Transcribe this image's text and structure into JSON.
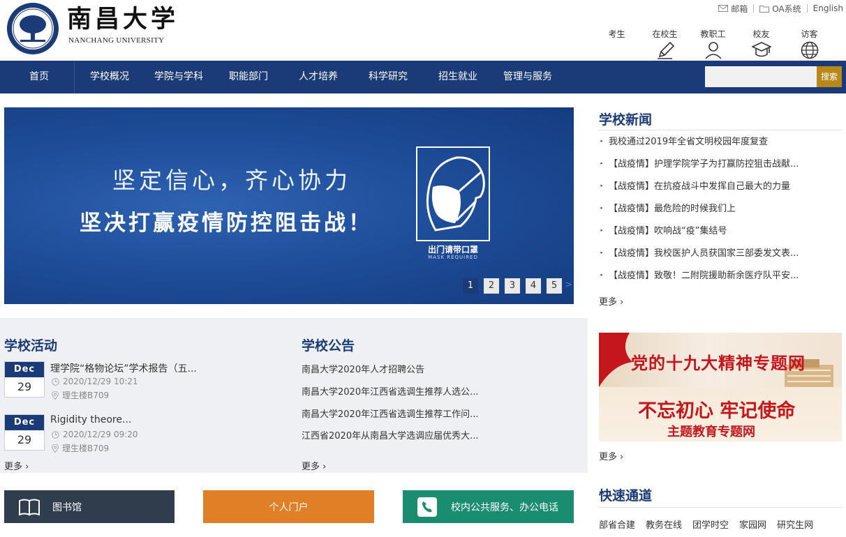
{
  "header": {
    "logo_cn": "南昌大学",
    "logo_en": "NANCHANG UNIVERSITY",
    "toplinks": {
      "mail": "邮箱",
      "oa": "OA系统",
      "english": "English"
    },
    "roles": [
      "考生",
      "在校生",
      "教职工",
      "校友",
      "访客"
    ]
  },
  "nav": {
    "items": [
      "首页",
      "学校概况",
      "学院与学科",
      "职能部门",
      "人才培养",
      "科学研究",
      "招生就业",
      "管理与服务"
    ],
    "search_button": "搜索",
    "search_placeholder": ""
  },
  "banner": {
    "line1": "坚定信心，齐心协力",
    "line2": "坚决打赢疫情防控阻击战！",
    "mask_caption": "出门请带口罩",
    "mask_caption_en": "MASK REQUIRED",
    "pages": [
      "1",
      "2",
      "3",
      "4",
      "5"
    ],
    "next": ">"
  },
  "news": {
    "title": "学校新闻",
    "items": [
      "我校通过2019年全省文明校园年度复查",
      "【战疫情】护理学院学子为打赢防控狙击战献...",
      "【战疫情】在抗疫战斗中发挥自己最大的力量",
      "【战疫情】最危险的时候我们上",
      "【战疫情】吹响战“疫”集结号",
      "【战疫情】我校医护人员获国家三部委发文表...",
      "【战疫情】致敬！二附院援助新余医疗队平安..."
    ],
    "more": "更多 ›"
  },
  "activities": {
    "title": "学校活动",
    "items": [
      {
        "month": "Dec",
        "day": "29",
        "title": "理学院“格物论坛”学术报告（五...",
        "time": "2020/12/29 10:21",
        "place": "理生楼B709"
      },
      {
        "month": "Dec",
        "day": "29",
        "title": "Rigidity theore...",
        "time": "2020/12/29 09:20",
        "place": "理生楼B709"
      }
    ],
    "more": "更多 ›"
  },
  "notices": {
    "title": "学校公告",
    "items": [
      "南昌大学2020年人才招聘公告",
      "南昌大学2020年江西省选调生推荐人选公...",
      "南昌大学2020年江西省选调生推荐工作问...",
      "江西省2020年从南昌大学选调应届优秀大..."
    ],
    "more": "更多 ›"
  },
  "promo": {
    "line1": "党的十九大精神专题网",
    "line2": "不忘初心 牢记使命",
    "line3": "主题教育专题网",
    "more": "更多 ›"
  },
  "tiles": {
    "library": "图书馆",
    "portal": "个人门户",
    "services": "校内公共服务、办公电话"
  },
  "quick": {
    "title": "快速通道",
    "links": [
      "部省合建",
      "教务在线",
      "团学时空",
      "家园网",
      "研究生网"
    ]
  },
  "colors": {
    "primary": "#1a3a78",
    "accent_gold": "#b8891a",
    "library_tile": "#2f3d4d",
    "portal_tile": "#e07f26",
    "services_tile": "#1a8c70",
    "news_bullet": "#c0392b"
  }
}
